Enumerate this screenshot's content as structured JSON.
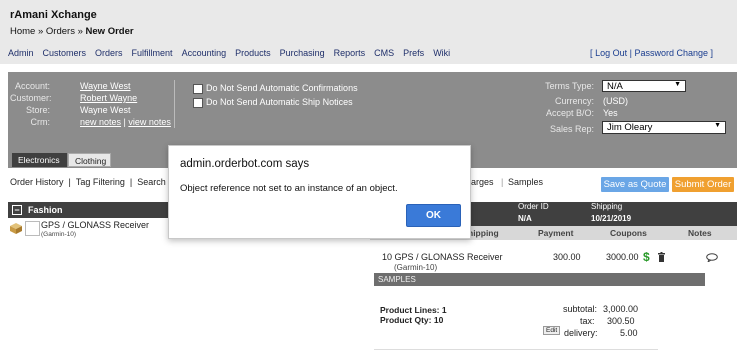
{
  "header": {
    "app_title": "rAmani Xchange",
    "breadcrumb": [
      "Home",
      "Orders",
      "New Order"
    ],
    "nav": [
      "Admin",
      "Customers",
      "Orders",
      "Fulfillment",
      "Accounting",
      "Products",
      "Purchasing",
      "Reports",
      "CMS",
      "Prefs",
      "Wiki"
    ],
    "logout": "Log Out",
    "password_change": "Password Change"
  },
  "customer": {
    "account_label": "Account:",
    "account": "Wayne West",
    "customer_label": "Customer:",
    "customer": "Robert Wayne",
    "store_label": "Store:",
    "store": "Wayne West",
    "crm_label": "Crm:",
    "crm_new_notes": "new notes",
    "crm_view_notes": "view notes",
    "no_confirmations": "Do Not Send Automatic Confirmations",
    "no_ship_notices": "Do Not Send Automatic Ship Notices",
    "terms_label": "Terms Type:",
    "terms": "N/A",
    "currency_label": "Currency:",
    "currency": "(USD)",
    "accept_bo_label": "Accept B/O:",
    "accept_bo": "Yes",
    "sales_rep_label": "Sales Rep:",
    "sales_rep": "Jim Oleary"
  },
  "tabs": [
    "Electronics",
    "Clothing"
  ],
  "toolbar": {
    "items": [
      "Order History",
      "Tag Filtering",
      "Search"
    ],
    "charges": "harges",
    "samples": "Samples",
    "save_quote": "Save as Quote",
    "submit_order": "Submit Order"
  },
  "catalog": {
    "category": "Fashion",
    "product_name": "GPS / GLONASS Receiver",
    "product_sku": "(Garmin-10)"
  },
  "order": {
    "order_id_label": "Order ID",
    "order_id": "N/A",
    "shipping_label": "Shipping",
    "shipping_date": "10/21/2019",
    "columns": [
      "hipping",
      "Payment",
      "Coupons",
      "Notes"
    ],
    "line_item": {
      "name": "10 GPS / GLONASS Receiver",
      "sku": "(Garmin-10)",
      "payment": "300.00",
      "coupons": "3000.00"
    },
    "samples_bar": "SAMPLES",
    "product_lines_label": "Product Lines:",
    "product_lines": "1",
    "product_qty_label": "Product Qty:",
    "product_qty": "10",
    "subtotal_label": "subtotal:",
    "subtotal": "3,000.00",
    "tax_label": "tax:",
    "tax": "300.50",
    "delivery_label": "delivery:",
    "delivery": "5.00",
    "edit": "Edit"
  },
  "dialog": {
    "title": "admin.orderbot.com says",
    "message": "Object reference not set to an instance of an object.",
    "ok": "OK"
  },
  "colors": {
    "save_quote": "#6aa6e6",
    "submit_order": "#f0a030",
    "dialog_ok": "#3a7ad8",
    "dark_bar": "#404040"
  }
}
